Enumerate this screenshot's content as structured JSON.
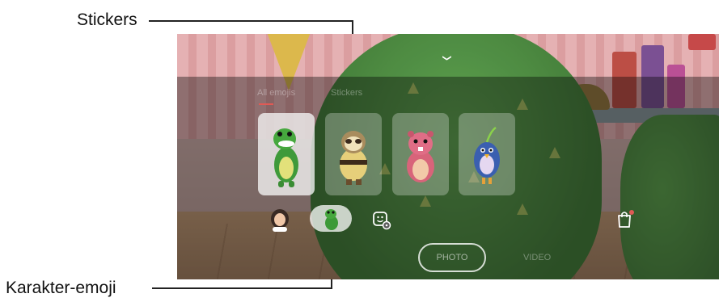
{
  "callouts": {
    "stickers": "Stickers",
    "ar_emoji": "Karakter-emoji"
  },
  "screen": {
    "tabs": [
      "All emojis",
      "Stickers"
    ],
    "active_tab_index": 0,
    "cards": [
      {
        "name": "green-dino",
        "selected": true
      },
      {
        "name": "sloth",
        "selected": false
      },
      {
        "name": "pink-beaver",
        "selected": false
      },
      {
        "name": "blue-bird",
        "selected": false
      }
    ],
    "bottom_icons": [
      "my-emoji-avatar-icon",
      "ar-emoji-dino-icon",
      "emoji-settings-icon",
      "store-bag-icon"
    ],
    "modes": {
      "photo": "PHOTO",
      "video": "VIDEO"
    },
    "colors": {
      "accent": "#e05a55",
      "panel": "rgba(40,40,40,0.45)"
    }
  }
}
